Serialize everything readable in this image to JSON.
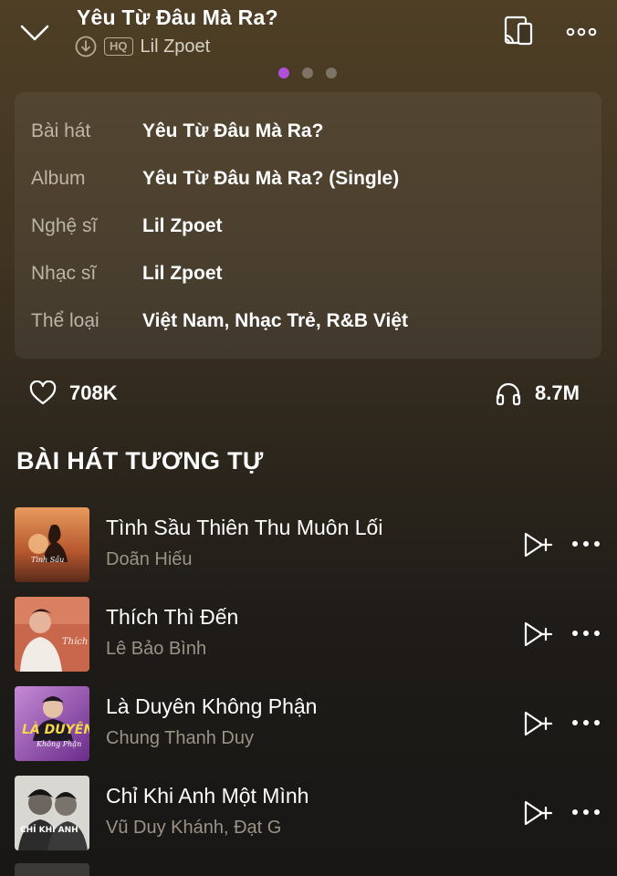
{
  "header": {
    "title": "Yêu Từ Đâu Mà Ra?",
    "quality_badge": "HQ",
    "artist": "Lil Zpoet",
    "icons": [
      "chevron-down-icon",
      "download-icon",
      "cast-icon",
      "more-icon"
    ],
    "pager": {
      "count": 3,
      "active": 0,
      "active_color": "#b04fd8"
    }
  },
  "info": {
    "rows": [
      {
        "label": "Bài hát",
        "value": "Yêu Từ Đâu Mà Ra?"
      },
      {
        "label": "Album",
        "value": "Yêu Từ Đâu Mà Ra? (Single)"
      },
      {
        "label": "Nghệ sĩ",
        "value": "Lil Zpoet"
      },
      {
        "label": "Nhạc sĩ",
        "value": "Lil Zpoet"
      },
      {
        "label": "Thể loại",
        "value": "Việt Nam, Nhạc Trẻ, R&B Việt"
      }
    ]
  },
  "stats": {
    "likes": "708K",
    "listens": "8.7M"
  },
  "similar": {
    "heading": "BÀI HÁT TƯƠNG TỰ",
    "items": [
      {
        "title": "Tình Sầu Thiên Thu Muôn Lối",
        "artist": "Doãn Hiếu"
      },
      {
        "title": "Thích Thì Đến",
        "artist": "Lê Bảo Bình"
      },
      {
        "title": "Là Duyên Không Phận",
        "artist": "Chung Thanh Duy"
      },
      {
        "title": "Chỉ Khi Anh Một Mình",
        "artist": "Vũ Duy Khánh, Đạt G"
      }
    ]
  }
}
